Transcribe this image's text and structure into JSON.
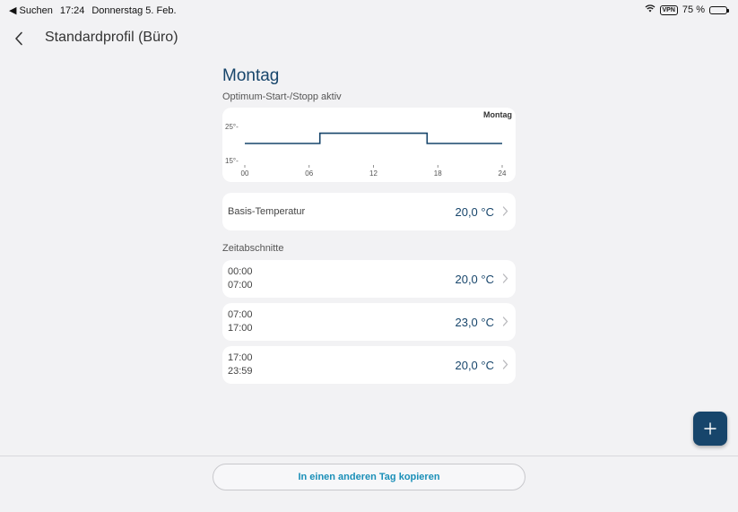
{
  "status_bar": {
    "back_app": "◀ Suchen",
    "time": "17:24",
    "date": "Donnerstag 5. Feb.",
    "vpn": "VPN",
    "battery": "75 %",
    "battery_level": 0.75
  },
  "nav": {
    "title": "Standardprofil (Büro)"
  },
  "day": {
    "title": "Montag",
    "subtitle": "Optimum-Start-/Stopp aktiv"
  },
  "chart_data": {
    "type": "line",
    "day_label": "Montag",
    "y_ticks": [
      "25°-",
      "15°-"
    ],
    "x_ticks": [
      "00",
      "06",
      "12",
      "18",
      "24"
    ],
    "ylim": [
      15,
      25
    ],
    "xlim": [
      0,
      24
    ],
    "series": [
      {
        "values": [
          [
            0,
            20
          ],
          [
            7,
            20
          ],
          [
            7,
            23
          ],
          [
            17,
            23
          ],
          [
            17,
            20
          ],
          [
            24,
            20
          ]
        ]
      }
    ],
    "color": "#17456b"
  },
  "base": {
    "label": "Basis-Temperatur",
    "value": "20,0 °C"
  },
  "periods_header": "Zeitabschnitte",
  "periods": [
    {
      "start": "00:00",
      "end": "07:00",
      "value": "20,0 °C"
    },
    {
      "start": "07:00",
      "end": "17:00",
      "value": "23,0 °C"
    },
    {
      "start": "17:00",
      "end": "23:59",
      "value": "20,0 °C"
    }
  ],
  "copy_button": "In einen anderen Tag kopieren",
  "colors": {
    "accent": "#17456b",
    "link": "#1a8fb8",
    "background": "#f2f2f4"
  }
}
